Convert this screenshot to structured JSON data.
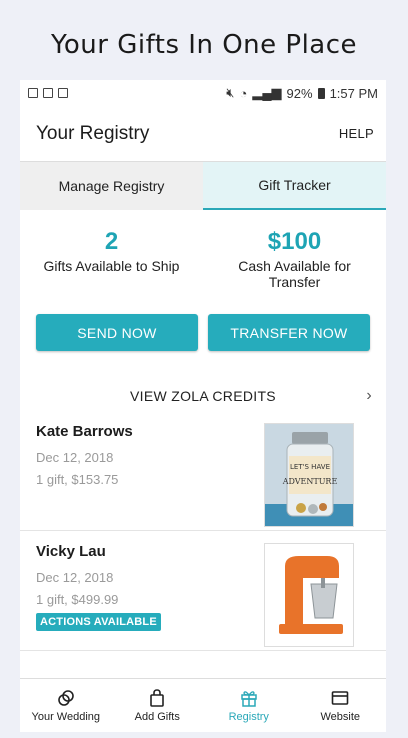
{
  "headline": "Your Gifts In One Place",
  "status_bar": {
    "battery": "92%",
    "time": "1:57 PM"
  },
  "app_bar": {
    "title": "Your Registry",
    "help": "HELP"
  },
  "tabs": [
    {
      "label": "Manage Registry",
      "active": false
    },
    {
      "label": "Gift Tracker",
      "active": true
    }
  ],
  "stats": {
    "gifts_count": "2",
    "gifts_label": "Gifts Available to Ship",
    "cash_amount": "$100",
    "cash_label": "Cash Available for Transfer"
  },
  "buttons": {
    "send": "SEND NOW",
    "transfer": "TRANSFER NOW"
  },
  "credits_link": "VIEW ZOLA CREDITS",
  "gifts": [
    {
      "name": "Kate Barrows",
      "date": "Dec 12, 2018",
      "detail": "1 gift, $153.75",
      "badge": ""
    },
    {
      "name": "Vicky Lau",
      "date": "Dec 12, 2018",
      "detail": "1 gift, $499.99",
      "badge": "ACTIONS AVAILABLE"
    }
  ],
  "bottom_nav": [
    {
      "label": "Your Wedding",
      "icon": "rings-icon",
      "active": false
    },
    {
      "label": "Add Gifts",
      "icon": "bag-icon",
      "active": false
    },
    {
      "label": "Registry",
      "icon": "gift-icon",
      "active": true
    },
    {
      "label": "Website",
      "icon": "browser-icon",
      "active": false
    }
  ],
  "colors": {
    "accent": "#26acbc",
    "accent_text": "#1ea4b4",
    "background": "#eef0f7"
  }
}
